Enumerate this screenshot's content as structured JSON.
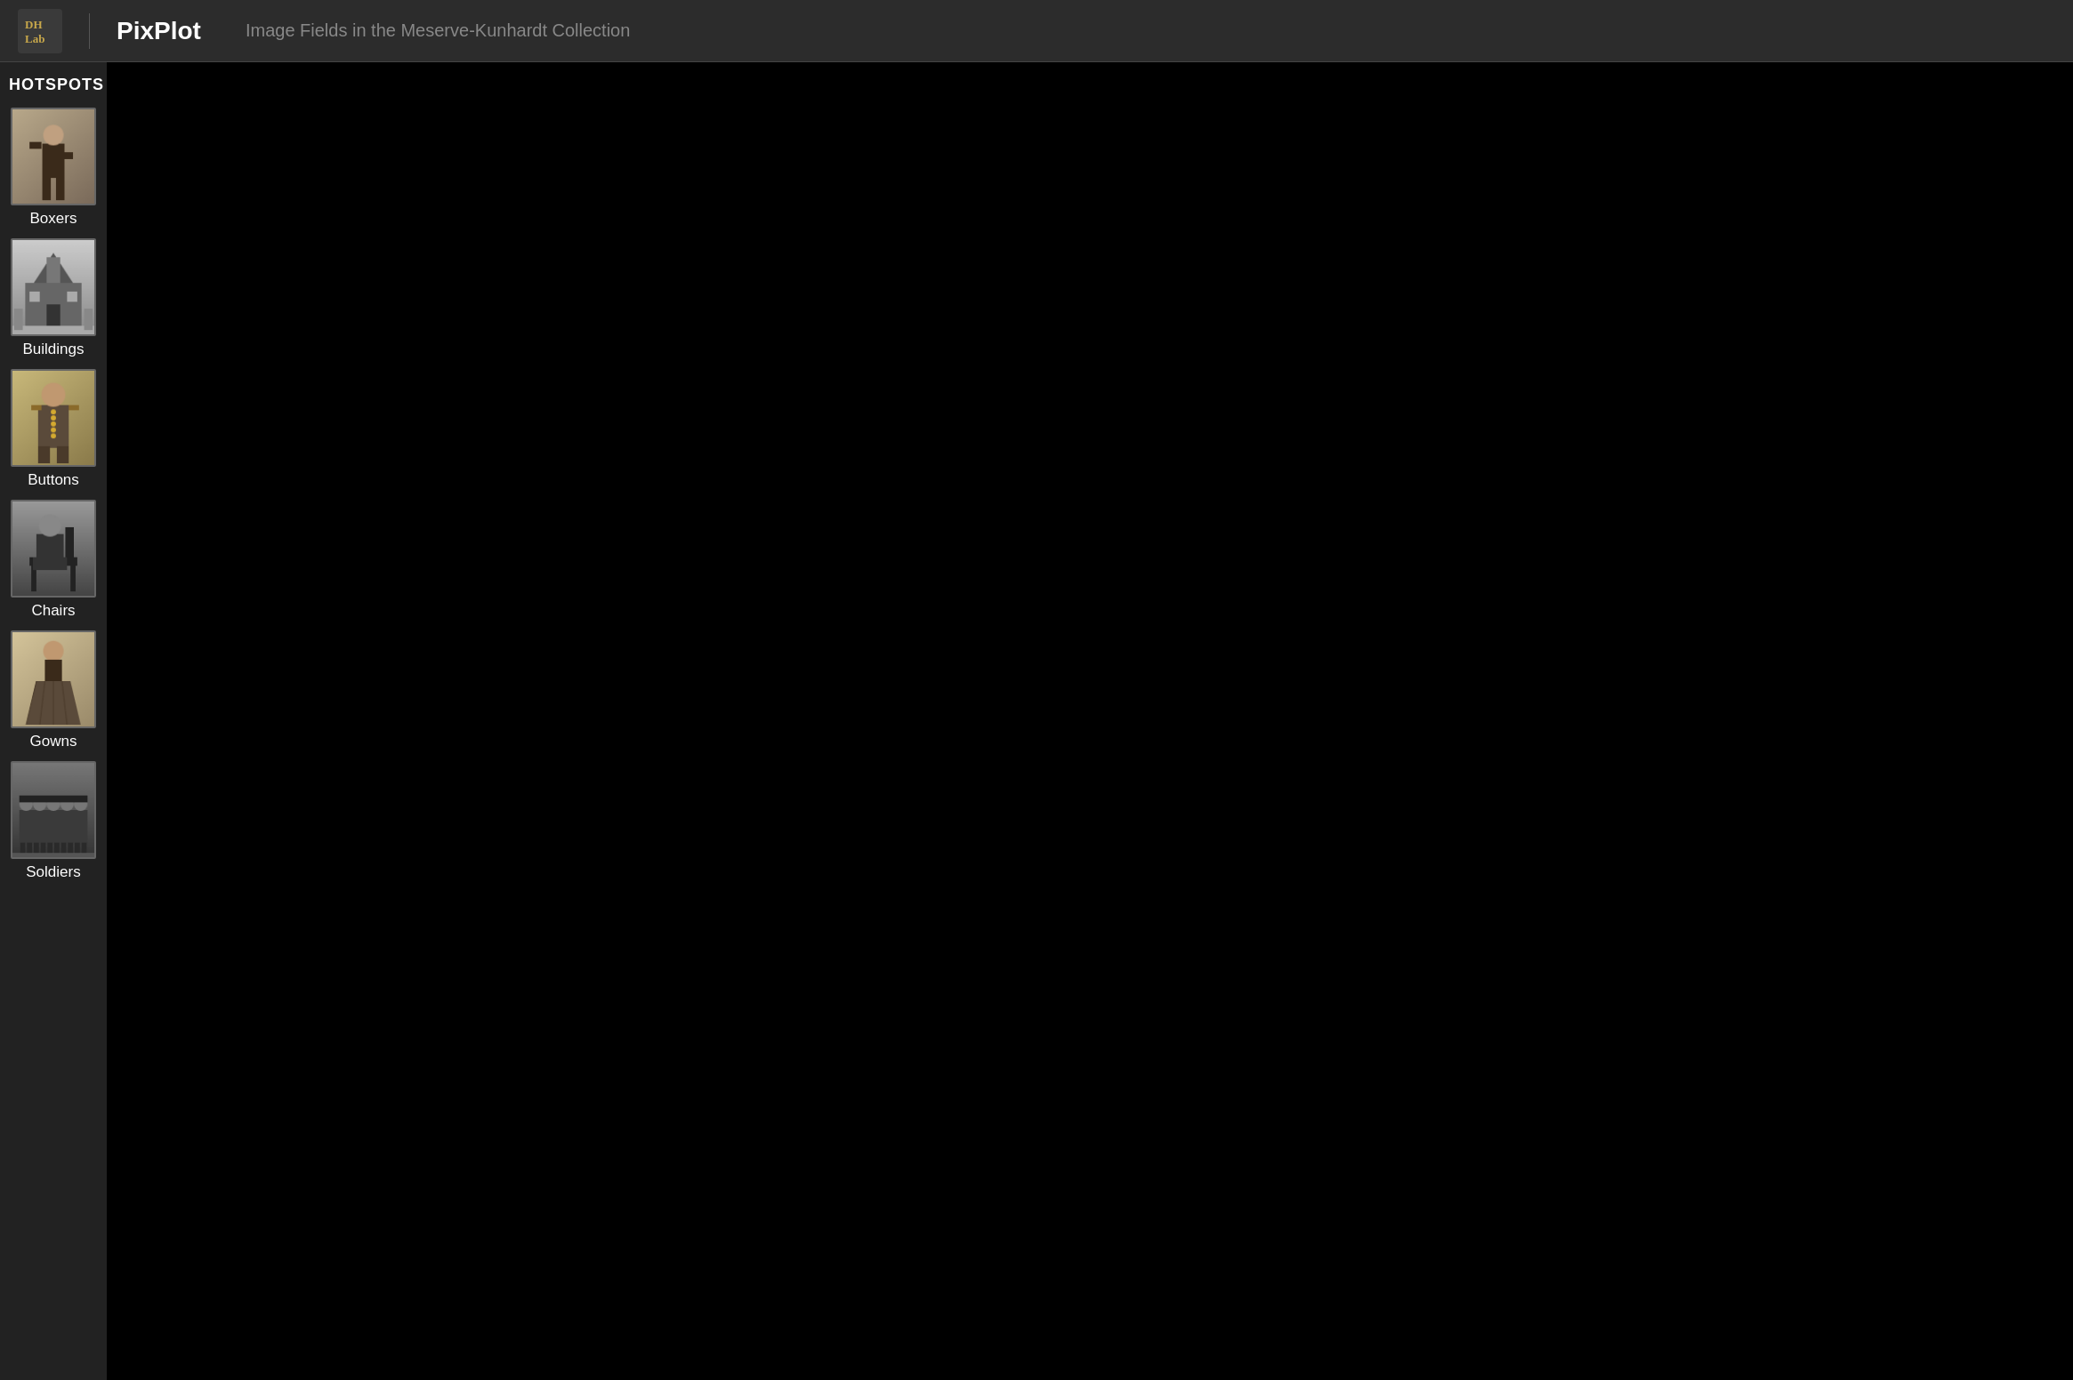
{
  "header": {
    "logo_line1": "DH",
    "logo_line2": "Lab",
    "app_title": "PixPlot",
    "subtitle": "Image Fields in the Meserve-Kunhardt Collection"
  },
  "sidebar": {
    "section_label": "HOTSPOTS",
    "items": [
      {
        "id": "boxers",
        "name": "Boxers",
        "thumb_class": "thumb-boxers"
      },
      {
        "id": "buildings",
        "name": "Buildings",
        "thumb_class": "thumb-buildings"
      },
      {
        "id": "buttons",
        "name": "Buttons",
        "thumb_class": "thumb-buttons"
      },
      {
        "id": "chairs",
        "name": "Chairs",
        "thumb_class": "thumb-chairs"
      },
      {
        "id": "gowns",
        "name": "Gowns",
        "thumb_class": "thumb-gowns"
      },
      {
        "id": "soldiers",
        "name": "Soldiers",
        "thumb_class": "thumb-soldiers"
      }
    ]
  },
  "viz": {
    "background_color": "#000000"
  }
}
